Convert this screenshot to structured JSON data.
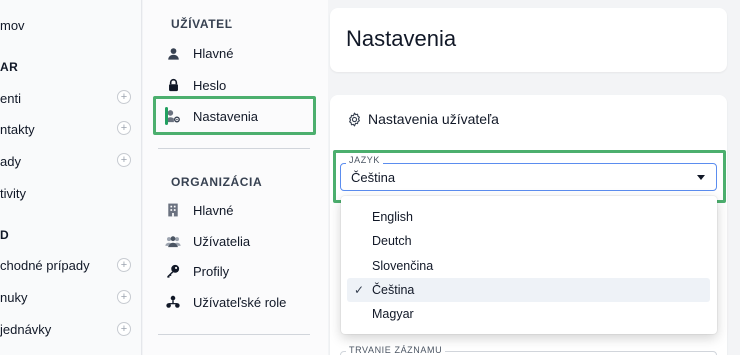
{
  "left_sidebar": {
    "items": [
      {
        "label": "mov"
      },
      {
        "section": "AR"
      },
      {
        "label": "enti",
        "plus": true
      },
      {
        "label": "ntakty",
        "plus": true
      },
      {
        "label": "ady",
        "plus": true
      },
      {
        "label": "tivity"
      },
      {
        "section": "D"
      },
      {
        "label": "chodné prípady",
        "plus": true
      },
      {
        "label": "nuky",
        "plus": true
      },
      {
        "label": "jednávky",
        "plus": true
      }
    ],
    "plus_symbol": "+"
  },
  "settings_nav": {
    "user_section": "UŽÍVATEĽ",
    "user_items": [
      {
        "label": "Hlavné",
        "icon": "user-icon"
      },
      {
        "label": "Heslo",
        "icon": "lock-icon"
      },
      {
        "label": "Nastavenia",
        "icon": "user-settings-icon",
        "active": true
      }
    ],
    "org_section": "ORGANIZÁCIA",
    "org_items": [
      {
        "label": "Hlavné",
        "icon": "building-icon"
      },
      {
        "label": "Užívatelia",
        "icon": "users-icon"
      },
      {
        "label": "Profily",
        "icon": "key-icon"
      },
      {
        "label": "Užívateľské role",
        "icon": "roles-icon"
      }
    ]
  },
  "main": {
    "title": "Nastavenia",
    "card_heading": "Nastavenia užívateľa",
    "language_field": {
      "label": "JAZYK",
      "value": "Čeština",
      "options": [
        "English",
        "Deutch",
        "Slovenčina",
        "Čeština",
        "Magyar"
      ],
      "selected": "Čeština"
    },
    "next_field_label": "TRVANIE ZÁZNAMU"
  },
  "colors": {
    "highlight": "#4caf6e",
    "active_bar": "#22a060",
    "focus_border": "#5b8def"
  }
}
